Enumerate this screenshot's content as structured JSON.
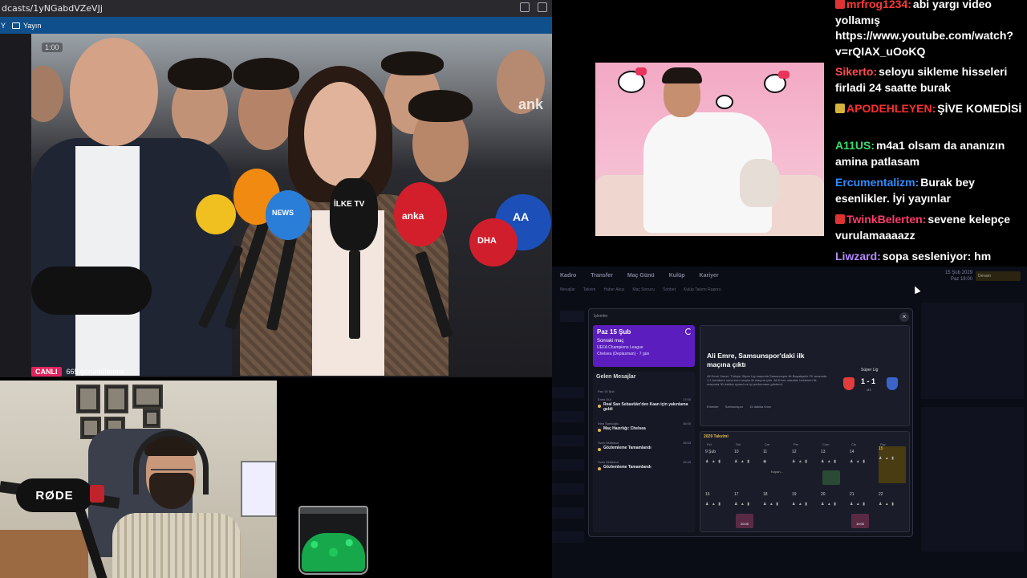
{
  "browser": {
    "url": "dcasts/1yNGabdVZeVJj",
    "bookmark_folder": "Yayın",
    "bookmark_first": "Y"
  },
  "video": {
    "timecode": "1:00",
    "watermark": "ank",
    "live_label": "CANLI",
    "views": "665 görüntülenme",
    "mic_labels": [
      "İLKE TV",
      "anka",
      "NEWS",
      "AA",
      "DHA"
    ]
  },
  "cam": {
    "mic_brand": "RØDE"
  },
  "chat": {
    "messages": [
      {
        "user": "mrfrog1234:",
        "text": "abi yargı video yollamış https://www.youtube.com/watch?v=rQIAX_uOoKQ",
        "user_color": "#ff3b3b",
        "badge": "red"
      },
      {
        "user": "Sikerto:",
        "text": "seloyu sikleme hisseleri firladi 24 saatte burak",
        "user_color": "#ff4d4d",
        "badge": "none"
      },
      {
        "user": "APODEHLEYEN:",
        "text": "ŞİVE KOMEDİSİ",
        "user_color": "#ff2e2e",
        "badge": "gold"
      },
      {
        "user": "A11US:",
        "text": "m4a1 olsam da ananızın amina patlasam",
        "user_color": "#3ddc6a",
        "badge": "none"
      },
      {
        "user": "Ercumentalizm:",
        "text": "Burak bey esenlikler. İyi yayınlar",
        "user_color": "#2f8cff",
        "badge": "none"
      },
      {
        "user": "TwinkBelerten:",
        "text": "sevene kelepçe vurulamaaaazz",
        "user_color": "#ff3b6b",
        "badge": "red"
      },
      {
        "user": "Liwzard:",
        "text": "sopa sesleniyor: hm",
        "user_color": "#b38aff",
        "badge": "none"
      }
    ]
  },
  "fm": {
    "nav": [
      "Kadro",
      "Transfer",
      "Maç Günü",
      "Kulüp",
      "Kariyer"
    ],
    "subnav": [
      "Mesajlar",
      "Takvim",
      "Haber Akışı",
      "Maç Sonucu",
      "Sohbet",
      "Kulüp Takımı Raporu"
    ],
    "date_line1": "15 Şub 2029",
    "date_line2": "Paz  19:00",
    "search_label": "Devam",
    "modal_header": "İşlemler",
    "close_label": "×",
    "next_match": {
      "date": "Paz 15 Şub",
      "label": "Sonraki maç",
      "competition": "UEFA Champions League",
      "opponent": "Chelsea (Deplasman) · 7 gün"
    },
    "inbox": {
      "title": "Gelen Mesajlar",
      "day": "Paz 15 Şub",
      "items": [
        {
          "sender": "Enes Gül",
          "subject": "Real San Sebastián'den Kaan için yakınlama geldi",
          "time": "17:00",
          "dot": "gold"
        },
        {
          "sender": "İrfan Sarıkoğlu",
          "subject": "Maç Hazırlığı: Chelsea",
          "time": "16:00",
          "dot": "gold"
        },
        {
          "sender": "Sven Müllstcut",
          "subject": "Gözlemleme Tamamlandı",
          "time": "15:53",
          "dot": "gold"
        },
        {
          "sender": "Sven Müllstcut",
          "subject": "Gözlemleme Tamamlandı",
          "time": "15:43",
          "dot": "gold"
        }
      ]
    },
    "news": {
      "headline": "Ali Emre, Samsunspor'daki ilk maçına çıktı",
      "body": "Ali Emre Yazıcı, Türkiye Süper Lig maçında Samsunspor ile Başakşehir FK arasında 1-1 berabere sona eren maçta ilk maçına çıktı. Ali Emre maraton beklenen ilk maçında 90 dakika oynadı ve iyi performans gösterdi.",
      "tags": [
        "Erkekler",
        "Samsunspor",
        "15 dakika önce"
      ],
      "league": "Süper Lig",
      "score": "1 - 1",
      "score_sub": "MS"
    },
    "calendar": {
      "title": "2029 Takvimi",
      "days_of_week": [
        "Pzt",
        "Sal",
        "Çar",
        "Per",
        "Cum",
        "Cts",
        "Paz"
      ],
      "week1": [
        "9 Şub",
        "10",
        "11",
        "12",
        "13",
        "14",
        "15"
      ],
      "week2": [
        "16",
        "17",
        "18",
        "19",
        "20",
        "21",
        "22"
      ],
      "match1_time": "20:00",
      "match2_time": "19:00",
      "match_label": "Kapan..."
    }
  }
}
